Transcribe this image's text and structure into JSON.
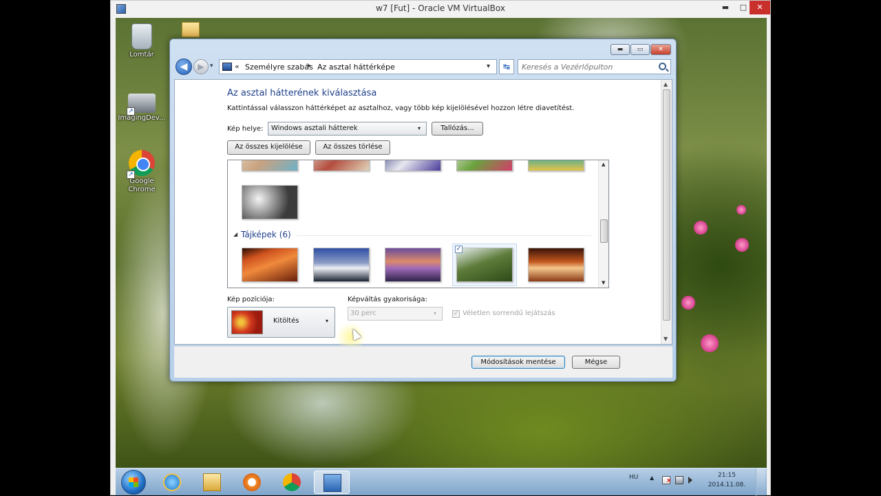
{
  "host_window": {
    "title": "w7 [Fut] - Oracle VM VirtualBox",
    "min_glyph": "▬",
    "max_glyph": "□",
    "close_glyph": "✕"
  },
  "desktop": {
    "icons": [
      {
        "label": "Lomtár",
        "icon": "recycle-bin-icon"
      },
      {
        "label": "ImagingDev...",
        "icon": "imaging-device-icon"
      },
      {
        "label": "Google Chrome",
        "icon": "chrome-icon"
      }
    ]
  },
  "window": {
    "min_glyph": "▬",
    "max_glyph": "▭",
    "close_glyph": "✕",
    "back_glyph": "◀",
    "forward_glyph": "▶",
    "history_glyph": "▾",
    "address": {
      "chevron": "«",
      "crumbs": [
        "Személyre szabás",
        "Az asztal háttérképe"
      ],
      "separator": "▸",
      "dropdown_glyph": "▾"
    },
    "refresh_glyph": "↹",
    "search": {
      "placeholder": "Keresés a Vezérlőpulton"
    }
  },
  "content": {
    "title": "Az asztal hátterének kiválasztása",
    "subtitle": "Kattintással válasszon háttérképet az asztalhoz, vagy több kép kijelölésével hozzon létre diavetítést.",
    "location": {
      "label": "Kép helye:",
      "selected": "Windows asztali hátterek",
      "arrow": "▾",
      "browse_label": "Tallózás..."
    },
    "select_all_label": "Az összes kijelölése",
    "clear_all_label": "Az összes törlése",
    "gallery": {
      "group_arrow": "◢",
      "group_label": "Tájképek (6)",
      "checked_glyph": "✓",
      "scroll_up": "▲",
      "scroll_down": "▼"
    },
    "position": {
      "label": "Kép pozíciója:",
      "selected": "Kitöltés",
      "arrow": "▾"
    },
    "frequency": {
      "label": "Képváltás gyakorisága:",
      "selected": "30 perc",
      "arrow": "▾"
    },
    "shuffle": {
      "label": "Véletlen sorrendű lejátszás",
      "checked_glyph": "✓"
    },
    "scroll_up": "▲",
    "scroll_down": "▼"
  },
  "footer": {
    "save_label": "Módosítások mentése",
    "cancel_label": "Mégse"
  },
  "taskbar": {
    "apps": [
      "internet-explorer-icon",
      "file-explorer-icon",
      "media-player-icon",
      "chrome-icon",
      "control-panel-icon"
    ],
    "language": "HU",
    "tray_up": "▲",
    "time": "21:15",
    "date": "2014.11.08."
  }
}
